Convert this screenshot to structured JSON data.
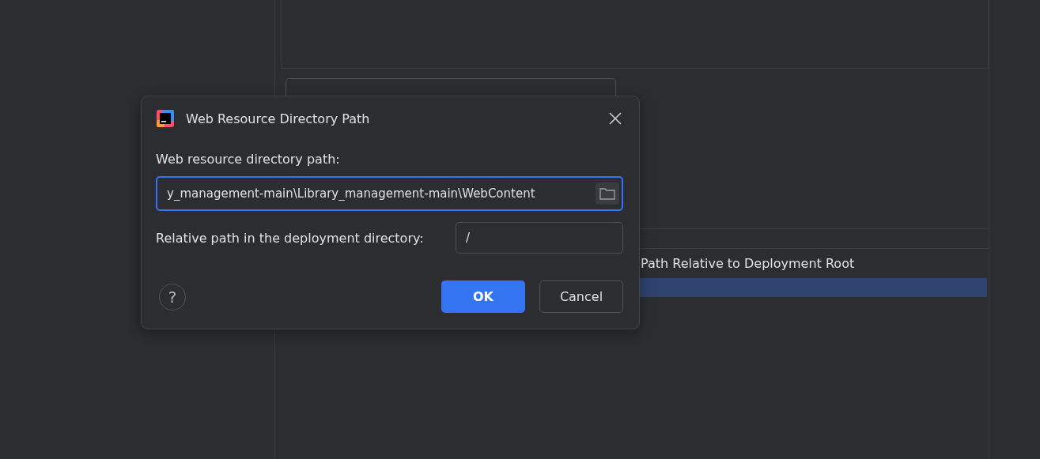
{
  "background": {
    "table": {
      "columns": [
        "Path Relative to Deployment Root"
      ],
      "rows": [
        {
          "selected": true
        }
      ]
    }
  },
  "dialog": {
    "title": "Web Resource Directory Path",
    "fields": [
      {
        "label": "Web resource directory path:",
        "value": "y_management-main\\Library_management-main\\WebContent",
        "focused": true
      },
      {
        "label": "Relative path in the deployment directory:",
        "value": "/",
        "focused": false
      }
    ],
    "help": "?",
    "buttons": [
      {
        "label": "OK",
        "kind": "primary"
      },
      {
        "label": "Cancel",
        "kind": "secondary"
      }
    ]
  }
}
